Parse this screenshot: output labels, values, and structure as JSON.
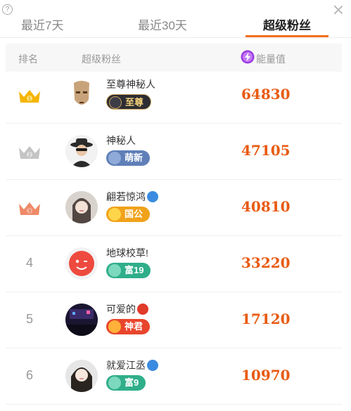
{
  "tabs": [
    {
      "label": "最近7天"
    },
    {
      "label": "最近30天"
    },
    {
      "label": "超级粉丝"
    }
  ],
  "header": {
    "rank": "排名",
    "fan": "超级粉丝",
    "energy": "能量值",
    "help_icon": "?"
  },
  "rows": [
    {
      "rank": "1",
      "name": "至尊神秘人",
      "badge": "至尊",
      "score": "64830",
      "avatar": "mask-avatar"
    },
    {
      "rank": "2",
      "name": "神秘人",
      "badge": "萌新",
      "score": "47105",
      "avatar": "hat-avatar"
    },
    {
      "rank": "3",
      "name": "翩若惊鸿",
      "badge": "国公",
      "score": "40810",
      "avatar": "girl-avatar"
    },
    {
      "rank": "4",
      "name": "地球校草!",
      "badge": "富19",
      "score": "33220",
      "avatar": "red-avatar"
    },
    {
      "rank": "5",
      "name": "可爱的",
      "badge": "神君",
      "score": "17120",
      "avatar": "night-avatar"
    },
    {
      "rank": "6",
      "name": "就爱江丞",
      "badge": "富9",
      "score": "10970",
      "avatar": "girl2-avatar"
    }
  ],
  "colors": {
    "accent": "#f36f1f",
    "score": "#e85a10",
    "gold_crown": "#f5b400",
    "silver_crown": "#c4c4c4",
    "bronze_crown": "#ef8a68"
  }
}
